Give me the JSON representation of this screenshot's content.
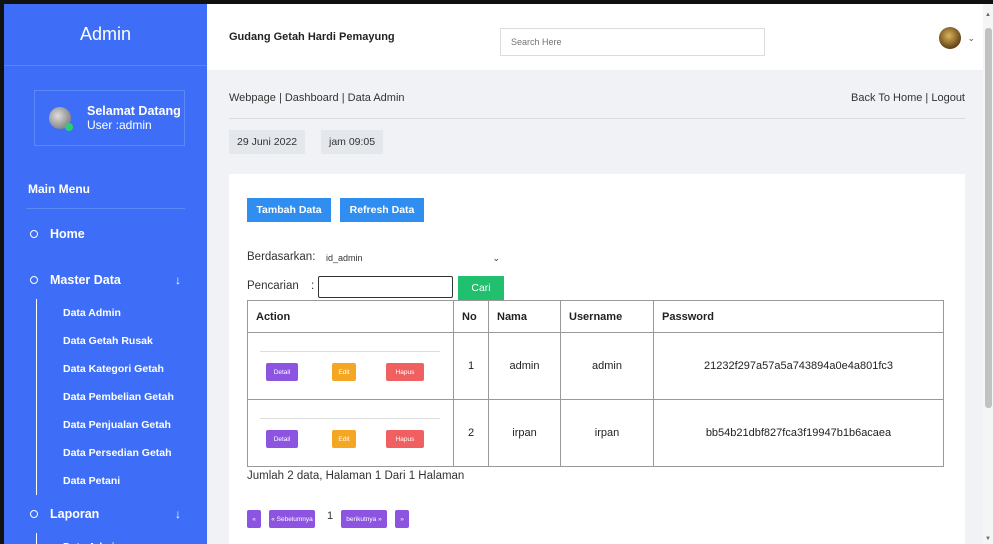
{
  "sidebar": {
    "brand": "Admin",
    "welcome": "Selamat Datang",
    "user": "User :admin",
    "main_menu": "Main Menu",
    "home": "Home",
    "master_data": "Master Data",
    "master_items": [
      "Data Admin",
      "Data Getah Rusak",
      "Data Kategori Getah",
      "Data Pembelian Getah",
      "Data Penjualan Getah",
      "Data Persedian Getah",
      "Data Petani"
    ],
    "laporan": "Laporan",
    "laporan_items": [
      "Data Admin"
    ]
  },
  "topbar": {
    "title": "Gudang Getah Hardi Pemayung",
    "search_placeholder": "Search Here"
  },
  "content": {
    "breadcrumb": "Webpage | Dashboard | Data Admin",
    "header_links": "Back To Home | Logout",
    "date": "29 Juni 2022",
    "time": "jam 09:05"
  },
  "card": {
    "tambah_label": "Tambah Data",
    "refresh_label": "Refresh Data",
    "berdasarkan_label": "Berdasarkan:",
    "select_value": "id_admin",
    "pencarian_label": "Pencarian",
    "colon": ":",
    "cari_label": "Cari",
    "columns": [
      "Action",
      "No",
      "Nama",
      "Username",
      "Password"
    ],
    "rows": [
      {
        "no": "1",
        "nama": "admin",
        "username": "admin",
        "password": "21232f297a57a5a743894a0e4a801fc3"
      },
      {
        "no": "2",
        "nama": "irpan",
        "username": "irpan",
        "password": "bb54b21dbf827fca3f19947b1b6acaea"
      }
    ],
    "row_actions": {
      "detail": "Detail",
      "edit": "Edit",
      "hapus": "Hapus"
    },
    "summary": "Jumlah 2 data, Halaman 1 Dari 1 Halaman",
    "pager": {
      "first": "«",
      "prev": "« Sebelumnya",
      "page": "1",
      "next": "berikutnya »",
      "last": "»"
    }
  }
}
